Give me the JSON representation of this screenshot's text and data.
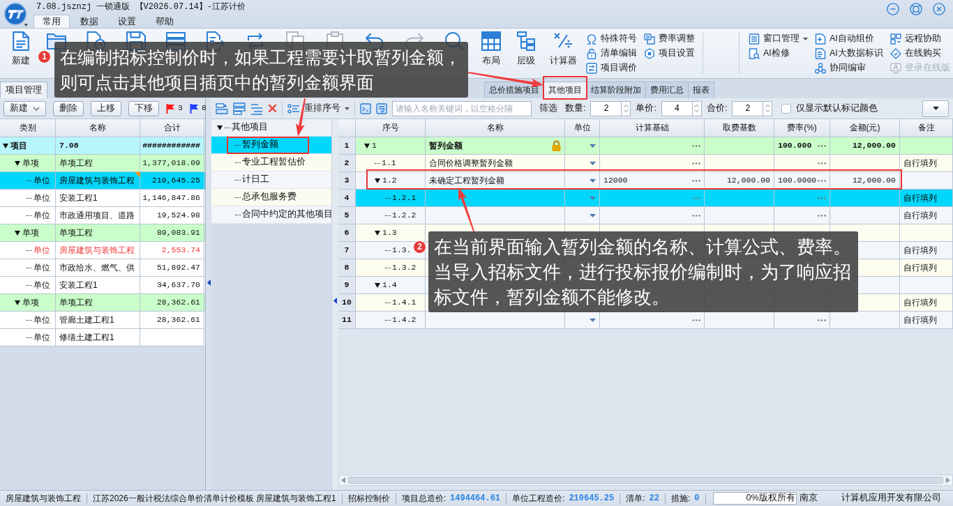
{
  "window": {
    "title": "7.08.jsznzj 一锁通版 【V2026.07.14】-江苏计价"
  },
  "menu_tabs": [
    {
      "label": "常用",
      "selected": true
    },
    {
      "label": "数据",
      "selected": false
    },
    {
      "label": "设置",
      "selected": false
    },
    {
      "label": "帮助",
      "selected": false
    }
  ],
  "ribbon": {
    "new_button": {
      "label": "新建"
    },
    "large_buttons": [
      {
        "label": "布局"
      },
      {
        "label": "层级"
      },
      {
        "label": "计算器"
      }
    ],
    "small_groups": [
      [
        {
          "label": "特殊符号",
          "dropdown": false,
          "disabled": false
        },
        {
          "label": "清单编辑",
          "dropdown": false,
          "disabled": false
        },
        {
          "label": "项目调价",
          "dropdown": false,
          "disabled": false
        }
      ],
      [
        {
          "label": "费率调整",
          "dropdown": false,
          "disabled": false
        },
        {
          "label": "项目设置",
          "dropdown": false,
          "disabled": false
        }
      ]
    ],
    "tool_groups": [
      [
        {
          "label": "窗口管理",
          "dropdown": true,
          "disabled": false
        },
        {
          "label": "AI检修",
          "dropdown": false,
          "disabled": false
        }
      ],
      [
        {
          "label": "AI自动组价",
          "dropdown": false,
          "disabled": false
        },
        {
          "label": "AI大数据标识",
          "dropdown": false,
          "disabled": false
        },
        {
          "label": "协同编审",
          "dropdown": false,
          "disabled": false
        }
      ],
      [
        {
          "label": "远程协助",
          "dropdown": false,
          "disabled": false
        },
        {
          "label": "在线购买",
          "dropdown": false,
          "disabled": false
        },
        {
          "label": "登录在线版",
          "dropdown": false,
          "disabled": true
        }
      ]
    ]
  },
  "panel_tab": {
    "label": "项目管理",
    "selected": true
  },
  "view_tabs": [
    {
      "label": "总价措施项目",
      "selected": false
    },
    {
      "label": "其他项目",
      "selected": true
    },
    {
      "label": "结算阶段附加",
      "selected": false
    },
    {
      "label": "费用汇总",
      "selected": false
    },
    {
      "label": "报表",
      "selected": false
    }
  ],
  "project_panel": {
    "buttons": [
      {
        "label": "新建",
        "dropdown": true
      },
      {
        "label": "删除",
        "dropdown": false
      },
      {
        "label": "上移",
        "dropdown": false
      },
      {
        "label": "下移",
        "dropdown": false
      }
    ],
    "flags": [
      {
        "color": "#ff1a1a",
        "count": "3"
      },
      {
        "color": "#1f3dff",
        "count": "8"
      }
    ],
    "columns": [
      "类别",
      "名称",
      "合计"
    ],
    "tree": [
      {
        "kind": "project",
        "type": "项目",
        "name": "7.08",
        "total": "############",
        "expanded": true,
        "selected": false,
        "warning": false,
        "marked": false,
        "children": [
          {
            "kind": "section",
            "type": "单项",
            "name": "单项工程",
            "total": "1,377,018.09",
            "expanded": true,
            "selected": false,
            "warning": false,
            "marked": false,
            "children": [
              {
                "kind": "unit",
                "type": "单位",
                "name": "房屋建筑与装饰工程",
                "total": "210,645.25",
                "selected": true,
                "warning": false,
                "marked": true
              },
              {
                "kind": "unit",
                "type": "单位",
                "name": "安装工程1",
                "total": "1,146,847.86",
                "selected": false,
                "warning": false,
                "marked": false
              },
              {
                "kind": "unit",
                "type": "单位",
                "name": "市政通用项目、道路",
                "total": "19,524.98",
                "selected": false,
                "warning": false,
                "marked": false
              }
            ]
          },
          {
            "kind": "section",
            "type": "单项",
            "name": "单项工程",
            "total": "89,083.91",
            "expanded": true,
            "selected": false,
            "warning": false,
            "marked": false,
            "children": [
              {
                "kind": "unit",
                "type": "单位",
                "name": "房屋建筑与装饰工程",
                "total": "2,553.74",
                "selected": false,
                "warning": true,
                "marked": false
              },
              {
                "kind": "unit",
                "type": "单位",
                "name": "市政给水、燃气、供",
                "total": "51,892.47",
                "selected": false,
                "warning": false,
                "marked": false
              },
              {
                "kind": "unit",
                "type": "单位",
                "name": "安装工程1",
                "total": "34,637.70",
                "selected": false,
                "warning": false,
                "marked": false
              }
            ]
          },
          {
            "kind": "section",
            "type": "单项",
            "name": "单项工程",
            "total": "28,362.61",
            "expanded": true,
            "selected": false,
            "warning": false,
            "marked": false,
            "children": [
              {
                "kind": "unit",
                "type": "单位",
                "name": "管廊土建工程1",
                "total": "28,362.61",
                "selected": false,
                "warning": false,
                "marked": false
              },
              {
                "kind": "unit",
                "type": "单位",
                "name": "修缮土建工程1",
                "selected": false,
                "warning": false,
                "marked": false
              }
            ]
          }
        ]
      }
    ]
  },
  "toolbar": {
    "reorder": {
      "label": "重排序号",
      "dropdown": true
    },
    "search": {
      "placeholder": "请输入名称关键词，以空格分隔"
    },
    "filter": "筛选",
    "spinners": [
      {
        "label": "数量:",
        "value": "2"
      },
      {
        "label": "单价:",
        "value": "4"
      },
      {
        "label": "合价:",
        "value": "2"
      }
    ],
    "checkbox": {
      "label": "仅显示默认标记颜色",
      "checked": false
    }
  },
  "other_tree": [
    {
      "label": "其他项目",
      "expanded": true,
      "selected": false,
      "children": [
        {
          "label": "暂列金额",
          "selected": true
        },
        {
          "label": "专业工程暂估价",
          "selected": false
        },
        {
          "label": "计日工",
          "selected": false
        },
        {
          "label": "总承包服务费",
          "selected": false
        },
        {
          "label": "合同中约定的其他项目",
          "selected": false
        }
      ]
    }
  ],
  "grid": {
    "columns": [
      "序号",
      "名称",
      "单位",
      "计算基础",
      "取费基数",
      "费率(%)",
      "金额(元)",
      "备注"
    ],
    "rows": [
      {
        "num": "1",
        "code": "1",
        "name": "暂列金额",
        "kind": "total",
        "locked": true,
        "selected": false,
        "expanded": true,
        "cell_buttons": true,
        "rate": "100.000",
        "amount": "12,000.00",
        "children": [
          {
            "num": "2",
            "code": "1.1",
            "name": "合同价格调整暂列金额",
            "kind": "item",
            "locked": false,
            "selected": false,
            "cell_buttons": true,
            "note": "自行填列"
          },
          {
            "num": "3",
            "code": "1.2",
            "name": "未确定工程暂列金额",
            "kind": "item",
            "locked": false,
            "selected": false,
            "expanded": true,
            "cell_buttons": true,
            "basis": "12000",
            "base": "12,000.00",
            "rate": "100.0000",
            "amount": "12,000.00",
            "children": [
              {
                "num": "4",
                "code": "1.2.1",
                "kind": "item",
                "locked": false,
                "selected": true,
                "cell_buttons": true,
                "note": "自行填列"
              },
              {
                "num": "5",
                "code": "1.2.2",
                "kind": "item",
                "locked": false,
                "selected": false,
                "cell_buttons": true,
                "note": "自行填列"
              }
            ]
          },
          {
            "num": "6",
            "code": "1.3",
            "kind": "item",
            "locked": false,
            "selected": false,
            "expanded": true,
            "cell_buttons": false,
            "children": [
              {
                "num": "7",
                "code": "1.3.",
                "kind": "item",
                "locked": false,
                "selected": false,
                "cell_buttons": false,
                "note": "自行填列"
              },
              {
                "num": "8",
                "code": "1.3.2",
                "kind": "item",
                "locked": false,
                "selected": false,
                "cell_buttons": false,
                "note": "自行填列"
              }
            ]
          },
          {
            "num": "9",
            "code": "1.4",
            "kind": "item",
            "locked": false,
            "selected": false,
            "expanded": true,
            "cell_buttons": false,
            "children": [
              {
                "num": "10",
                "code": "1.4.1",
                "kind": "item",
                "locked": false,
                "selected": false,
                "cell_buttons": false,
                "note": "自行填列"
              },
              {
                "num": "11",
                "code": "1.4.2",
                "kind": "item",
                "locked": false,
                "selected": false,
                "cell_buttons": true,
                "note": "自行填列"
              }
            ]
          }
        ]
      }
    ]
  },
  "annotations": [
    {
      "number": "1",
      "text": "在编制招标控制价时，如果工程需要计取暂列金额，则可点击其他项目插页中的暂列金额界面"
    },
    {
      "number": "2",
      "text": "在当前界面输入暂列金额的名称、计算公式、费率。当导入招标文件，进行投标报价编制时，为了响应招标文件，暂列金额不能修改。"
    }
  ],
  "status_bar": {
    "texts": [
      "房屋建筑与装饰工程",
      "江苏2026一般计税法综合单价清单计价模板 房屋建筑与装饰工程1",
      "招标控制价"
    ],
    "stats": [
      {
        "label": "项目总造价:",
        "value": "1494464.61"
      },
      {
        "label": "单位工程造价:",
        "value": "210645.25"
      },
      {
        "label": "清单:",
        "value": "22"
      },
      {
        "label": "措施:",
        "value": "0"
      }
    ],
    "progress": {
      "level": 0,
      "text": "0%"
    },
    "copyright": "版权所有",
    "company_parts": [
      "南京",
      "计算机应用开发有限公司"
    ]
  }
}
